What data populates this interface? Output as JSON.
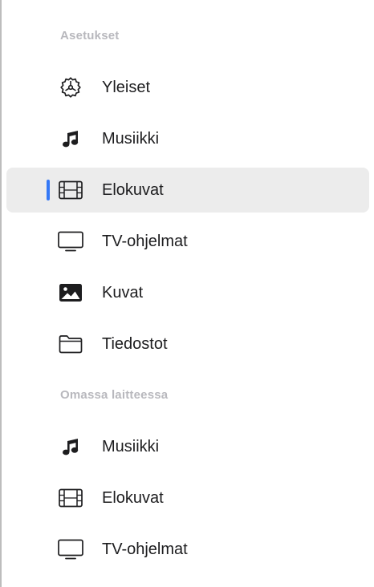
{
  "sections": [
    {
      "header": "Asetukset",
      "items": [
        {
          "label": "Yleiset",
          "icon": "gear-icon"
        },
        {
          "label": "Musiikki",
          "icon": "music-note-icon"
        },
        {
          "label": "Elokuvat",
          "icon": "film-icon",
          "selected": true
        },
        {
          "label": "TV-ohjelmat",
          "icon": "tv-icon"
        },
        {
          "label": "Kuvat",
          "icon": "photo-icon"
        },
        {
          "label": "Tiedostot",
          "icon": "folder-icon"
        }
      ]
    },
    {
      "header": "Omassa laitteessa",
      "items": [
        {
          "label": "Musiikki",
          "icon": "music-note-icon"
        },
        {
          "label": "Elokuvat",
          "icon": "film-icon"
        },
        {
          "label": "TV-ohjelmat",
          "icon": "tv-icon"
        }
      ]
    }
  ],
  "colors": {
    "accent": "#3478f6",
    "selected_background": "#ececec",
    "section_header": "#b8b8bd",
    "text": "#1d1d1f"
  }
}
